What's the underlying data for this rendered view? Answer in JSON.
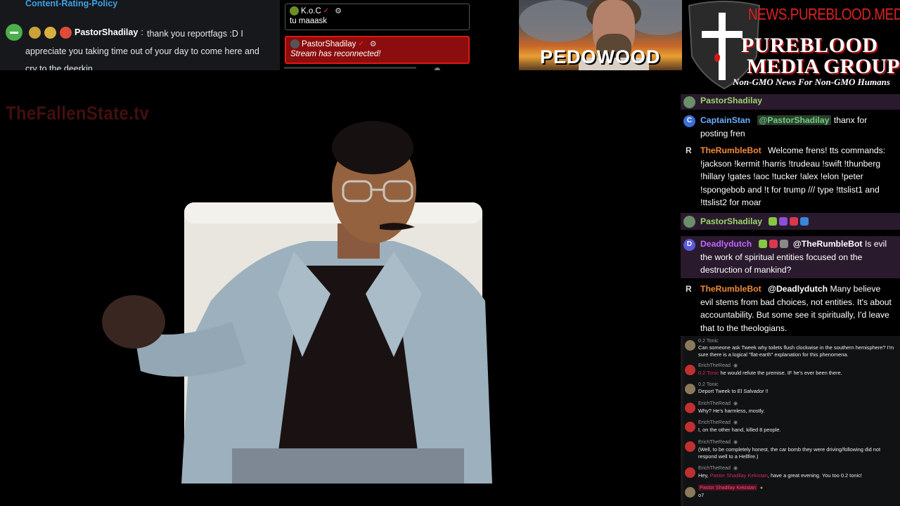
{
  "top_left_chat": {
    "policy_link": "Content-Rating-Policy",
    "message": {
      "username": "PastorShadilay",
      "separator": ":",
      "text": "thank you reportfags :D I appreciate you taking time out of your day to come here and cry to the deerkin"
    }
  },
  "notifications": [
    {
      "username": "K.o.C",
      "text": "tu maaask"
    },
    {
      "username": "PastorShadilay",
      "text": "Stream has reconnected!"
    }
  ],
  "thumbnail": {
    "overlay_text": "PEDOWOOD"
  },
  "brand": {
    "url": "NEWS.PUREBLOOD.MEDIA",
    "name_line1": "PUREBLOOD",
    "name_line2": "MEDIA GROUP",
    "tagline": "Non-GMO News For Non-GMO Humans"
  },
  "watermark": "TheFallenState.tv",
  "rumble_chat": {
    "messages": [
      {
        "username": "PastorShadilay",
        "text": "",
        "color": "#9ad66a"
      },
      {
        "username": "CaptainStan",
        "mention": "@PastorShadilay",
        "text": "thanx for posting fren",
        "avatar_letter": "C",
        "color": "#6ab0ff"
      },
      {
        "username": "TheRumbleBot",
        "text": "Welcome frens! tts commands: !jackson !kermit !harris !trudeau !swift !thunberg !hillary !gates !aoc !tucker !alex !elon !peter !spongebob and !t for trump /// type !ttslist1 and !ttslist2 for moar",
        "avatar_letter": "R",
        "color": "#f08a3a"
      },
      {
        "username": "PastorShadilay",
        "text": "",
        "color": "#9ad66a"
      },
      {
        "username": "Deadlydutch",
        "mention": "@TheRumbleBot",
        "text": "Is evil the work of spiritual entities focused on the destruction of mankind?",
        "avatar_letter": "D",
        "color": "#c266ff"
      },
      {
        "username": "TheRumbleBot",
        "mention": "@Deadlydutch",
        "text": "Many believe evil stems from bad choices, not entities. It's about accountability. But some see it spiritually, I'd leave that to the theologians.",
        "avatar_letter": "R",
        "color": "#f08a3a"
      }
    ]
  },
  "lower_chat": {
    "messages": [
      {
        "username": "0.2 Tonic",
        "text": "Can someone ask Tweek why toilets flush clockwise in the southern hemisphere? I'm sure there is a logical \"flat-earth\" explanation for this phenomena."
      },
      {
        "username": "ErichTheRead",
        "mention": "0.2 Tonic",
        "text": "he would refute the premise. IF he's ever been there."
      },
      {
        "username": "0.2 Tonic",
        "text": "Deport Tweek to El Salvador !!"
      },
      {
        "username": "ErichTheRead",
        "text": "Why? He's harmless, mostly."
      },
      {
        "username": "ErichTheRead",
        "text": "I, on the other hand, killed 8 people."
      },
      {
        "username": "ErichTheRead",
        "text": "(Well, to be completely honest, the car bomb they were driving/following did not respond well to a Hellfire.)"
      },
      {
        "username": "ErichTheRead",
        "text_before": "Hey,",
        "mention": "Pastor Shadilay Kekistan",
        "text": ", have a great evening. You too 0.2 tonic!"
      },
      {
        "username": "Pastor Shadilay Kekistan",
        "text": "o7"
      }
    ]
  },
  "icons": {
    "gear": "⚙",
    "check": "✓",
    "eye": "👁"
  }
}
